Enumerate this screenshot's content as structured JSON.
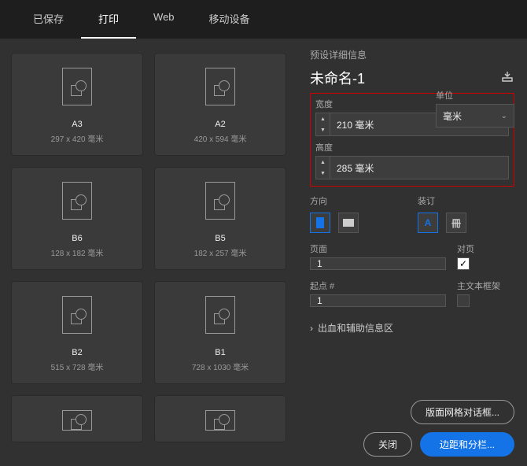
{
  "tabs": {
    "saved": "已保存",
    "print": "打印",
    "web": "Web",
    "mobile": "移动设备"
  },
  "presets": [
    {
      "name": "A3",
      "dims": "297 x 420 毫米"
    },
    {
      "name": "A2",
      "dims": "420 x 594 毫米"
    },
    {
      "name": "B6",
      "dims": "128 x 182 毫米"
    },
    {
      "name": "B5",
      "dims": "182 x 257 毫米"
    },
    {
      "name": "B2",
      "dims": "515 x 728 毫米"
    },
    {
      "name": "B1",
      "dims": "728 x 1030 毫米"
    }
  ],
  "detail": {
    "section_title": "预设详细信息",
    "docname_base": "未命名",
    "docname_suffix": "-1",
    "width_label": "宽度",
    "width_value": "210 毫米",
    "height_label": "高度",
    "height_value": "285 毫米",
    "unit_label": "单位",
    "unit_value": "毫米",
    "orientation_label": "方向",
    "binding_label": "装订",
    "pages_label": "页面",
    "pages_value": "1",
    "facing_label": "对页",
    "facing_checked": true,
    "start_label": "起点 #",
    "start_value": "1",
    "primary_frame_label": "主文本框架",
    "primary_frame_checked": false,
    "bleed_section": "出血和辅助信息区"
  },
  "buttons": {
    "layout_grid": "版面网格对话框...",
    "close": "关闭",
    "margins": "边距和分栏..."
  }
}
